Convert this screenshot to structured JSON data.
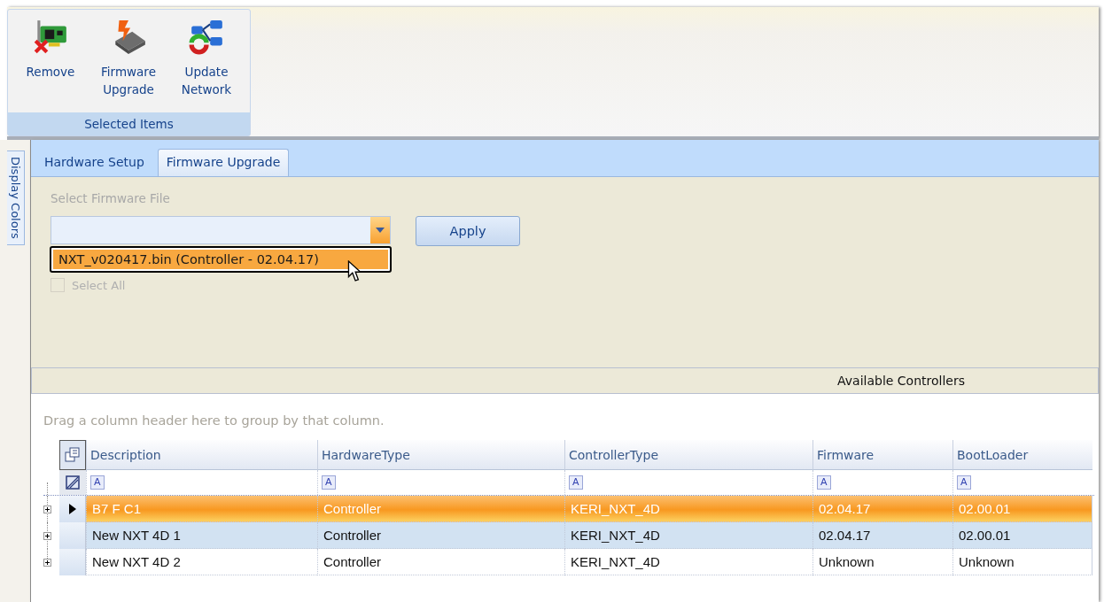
{
  "ribbon": {
    "group_label": "Selected Items",
    "buttons": [
      {
        "label": "Remove",
        "kind": "remove"
      },
      {
        "label": "Firmware Upgrade",
        "kind": "firmware"
      },
      {
        "label": "Update Network",
        "kind": "network"
      }
    ]
  },
  "side_tabs": [
    {
      "label": "Display Colors"
    }
  ],
  "tabs": [
    {
      "label": "Hardware Setup",
      "selected": false
    },
    {
      "label": "Firmware Upgrade",
      "selected": true
    }
  ],
  "firmware_panel": {
    "file_label": "Select Firmware File",
    "file_dropdown": {
      "expanded": true,
      "options": [
        {
          "label": "NXT_v020417.bin (Controller - 02.04.17)",
          "highlighted": true
        }
      ]
    },
    "apply_button": "Apply",
    "select_all": {
      "label": "Select All",
      "checked": false,
      "disabled": true
    }
  },
  "grid": {
    "title": "Available Controllers",
    "group_hint": "Drag a column header here to group by that column.",
    "columns": [
      {
        "label": "Description",
        "filter_glyph": "A"
      },
      {
        "label": "HardwareType",
        "filter_glyph": "A"
      },
      {
        "label": "ControllerType",
        "filter_glyph": "A"
      },
      {
        "label": "Firmware",
        "filter_glyph": "A"
      },
      {
        "label": "BootLoader",
        "filter_glyph": "A"
      }
    ],
    "rows": [
      {
        "cells": [
          "B7 F C1",
          "Controller",
          "KERI_NXT_4D",
          "02.04.17",
          "02.00.01"
        ],
        "selected": true,
        "focused": true,
        "expanded": false
      },
      {
        "cells": [
          "New NXT 4D 1",
          "Controller",
          "KERI_NXT_4D",
          "02.04.17",
          "02.00.01"
        ],
        "selected": true,
        "focused": false,
        "expanded": false
      },
      {
        "cells": [
          "New NXT 4D 2",
          "Controller",
          "KERI_NXT_4D",
          "Unknown",
          "Unknown"
        ],
        "selected": false,
        "focused": false,
        "expanded": false
      }
    ]
  }
}
